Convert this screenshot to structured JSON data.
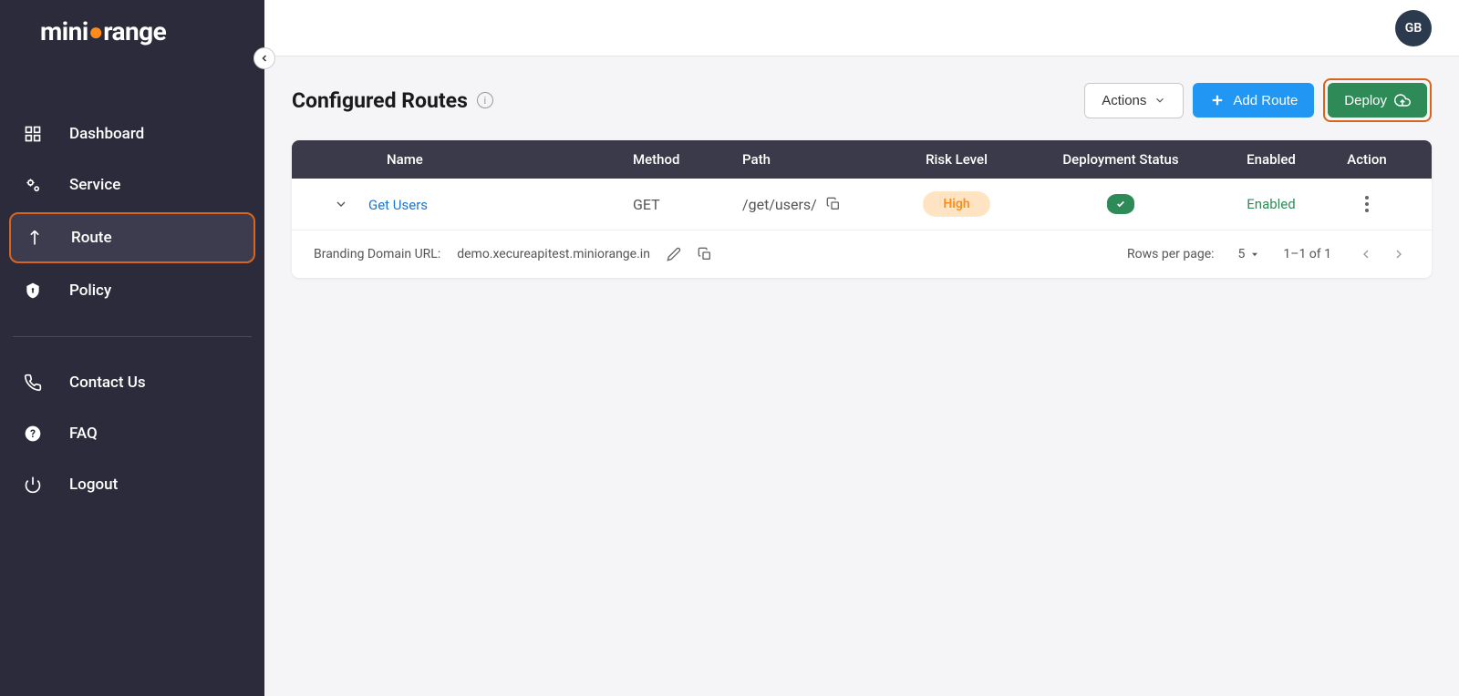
{
  "brand": {
    "prefix": "mini",
    "middle": "o",
    "suffix": "range"
  },
  "user": {
    "initials": "GB"
  },
  "sidebar": {
    "items": [
      {
        "label": "Dashboard"
      },
      {
        "label": "Service"
      },
      {
        "label": "Route"
      },
      {
        "label": "Policy"
      }
    ],
    "support": [
      {
        "label": "Contact Us"
      },
      {
        "label": "FAQ"
      },
      {
        "label": "Logout"
      }
    ]
  },
  "page": {
    "title": "Configured Routes"
  },
  "toolbar": {
    "actions_label": "Actions",
    "add_route_label": "Add Route",
    "deploy_label": "Deploy"
  },
  "table": {
    "headers": {
      "name": "Name",
      "method": "Method",
      "path": "Path",
      "risk": "Risk Level",
      "deploy": "Deployment Status",
      "enabled": "Enabled",
      "action": "Action"
    },
    "rows": [
      {
        "name": "Get Users",
        "method": "GET",
        "path": "/get/users/",
        "risk": "High",
        "enabled": "Enabled"
      }
    ]
  },
  "footer": {
    "branding_label": "Branding Domain URL:",
    "branding_url": "demo.xecureapitest.miniorange.in",
    "rows_per_page_label": "Rows per page:",
    "rows_per_page_value": "5",
    "pagination": "1–1 of 1"
  }
}
